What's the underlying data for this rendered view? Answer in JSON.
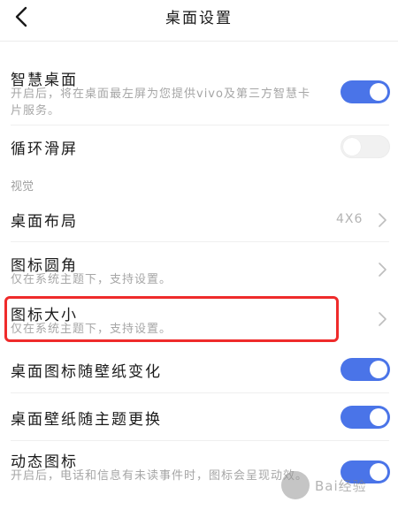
{
  "header": {
    "title": "桌面设置"
  },
  "settings": {
    "smart_desktop": {
      "title": "智慧桌面",
      "desc": "开启后，将在桌面最左屏为您提供vivo及第三方智慧卡片服务。",
      "state": "on"
    },
    "loop_scroll": {
      "title": "循环滑屏",
      "state": "off"
    },
    "section_visual": "视觉",
    "layout": {
      "title": "桌面布局",
      "value": "4X6"
    },
    "icon_corner": {
      "title": "图标圆角",
      "desc": "仅在系统主题下，支持设置。"
    },
    "icon_size": {
      "title": "图标大小",
      "desc": "仅在系统主题下，支持设置。"
    },
    "icon_follow_wallpaper": {
      "title": "桌面图标随壁纸变化",
      "state": "on"
    },
    "wallpaper_follow_theme": {
      "title": "桌面壁纸随主题更换",
      "state": "on"
    },
    "dynamic_icon": {
      "title": "动态图标",
      "desc": "开启后，电话和信息有未读事件时，图标会呈现动效。",
      "state": "on"
    }
  },
  "colors": {
    "accent": "#4a74e8",
    "highlight": "#ef2b2b"
  },
  "watermark": {
    "text": "Bai经验"
  }
}
